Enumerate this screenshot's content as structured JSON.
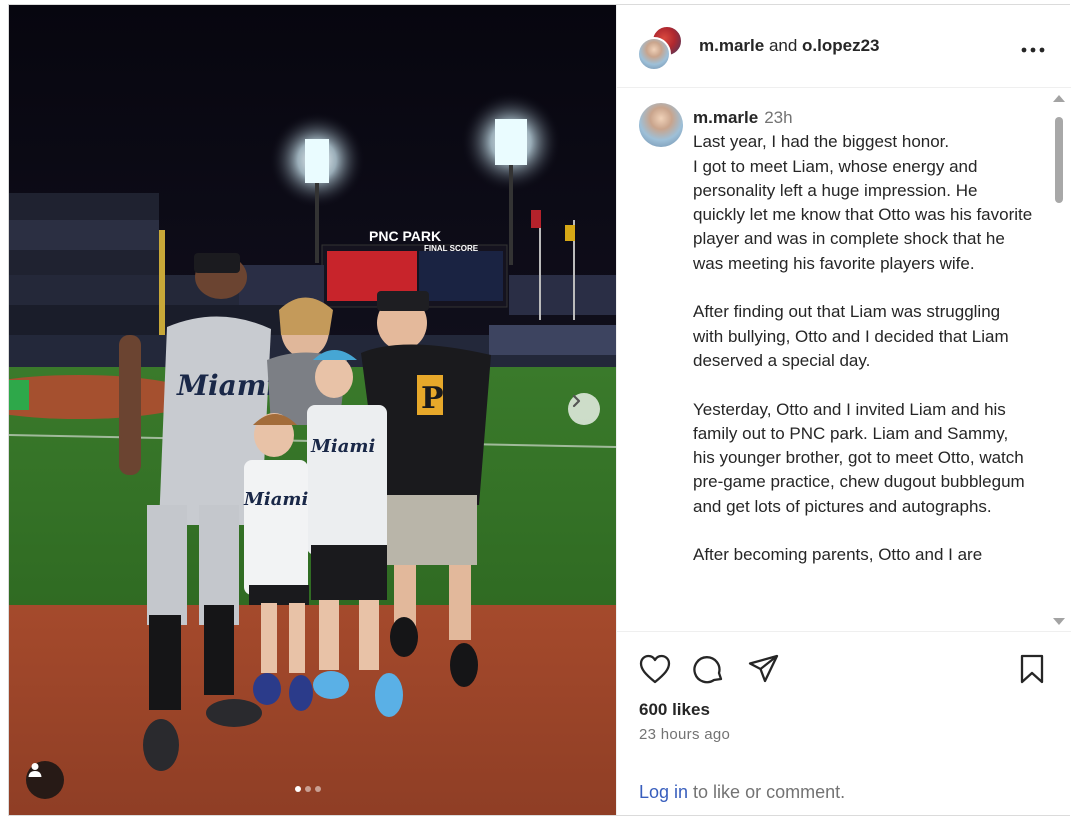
{
  "post": {
    "header": {
      "author": "m.marle",
      "and_text": "and",
      "collaborator": "o.lopez23",
      "more_icon": "more-horizontal-icon",
      "more_label": "•••"
    },
    "media": {
      "image_count": 3,
      "active_index": 0,
      "next_icon": "chevron-right-icon",
      "tag_icon": "user-tag-icon",
      "scoreboard_title": "PNC PARK",
      "scoreboard_final": "FINAL SCORE"
    },
    "caption": {
      "username": "m.marle",
      "time": "23h",
      "text": "Last year, I had the biggest honor.\nI got to meet Liam, whose energy and personality left a huge impression. He quickly let me know that Otto was his favorite player and was in complete shock that he was meeting his favorite players wife.\n\nAfter finding out that Liam was struggling with bullying, Otto and I decided that Liam deserved a special day.\n\nYesterday, Otto and I invited Liam and his family out to PNC park. Liam and Sammy, his younger brother, got to meet Otto, watch pre-game practice, chew dugout bubblegum and get lots of pictures and autographs.\n\nAfter becoming parents, Otto and I are"
    },
    "actions": {
      "like_icon": "heart-icon",
      "comment_icon": "comment-icon",
      "share_icon": "share-icon",
      "save_icon": "bookmark-icon",
      "likes": "600 likes",
      "time_ago": "23 hours ago"
    },
    "login": {
      "link": "Log in",
      "rest": " to like or comment."
    },
    "colors": {
      "link": "#385ebd",
      "muted": "#737373",
      "text": "#262626",
      "border": "#dbdbdb"
    }
  }
}
